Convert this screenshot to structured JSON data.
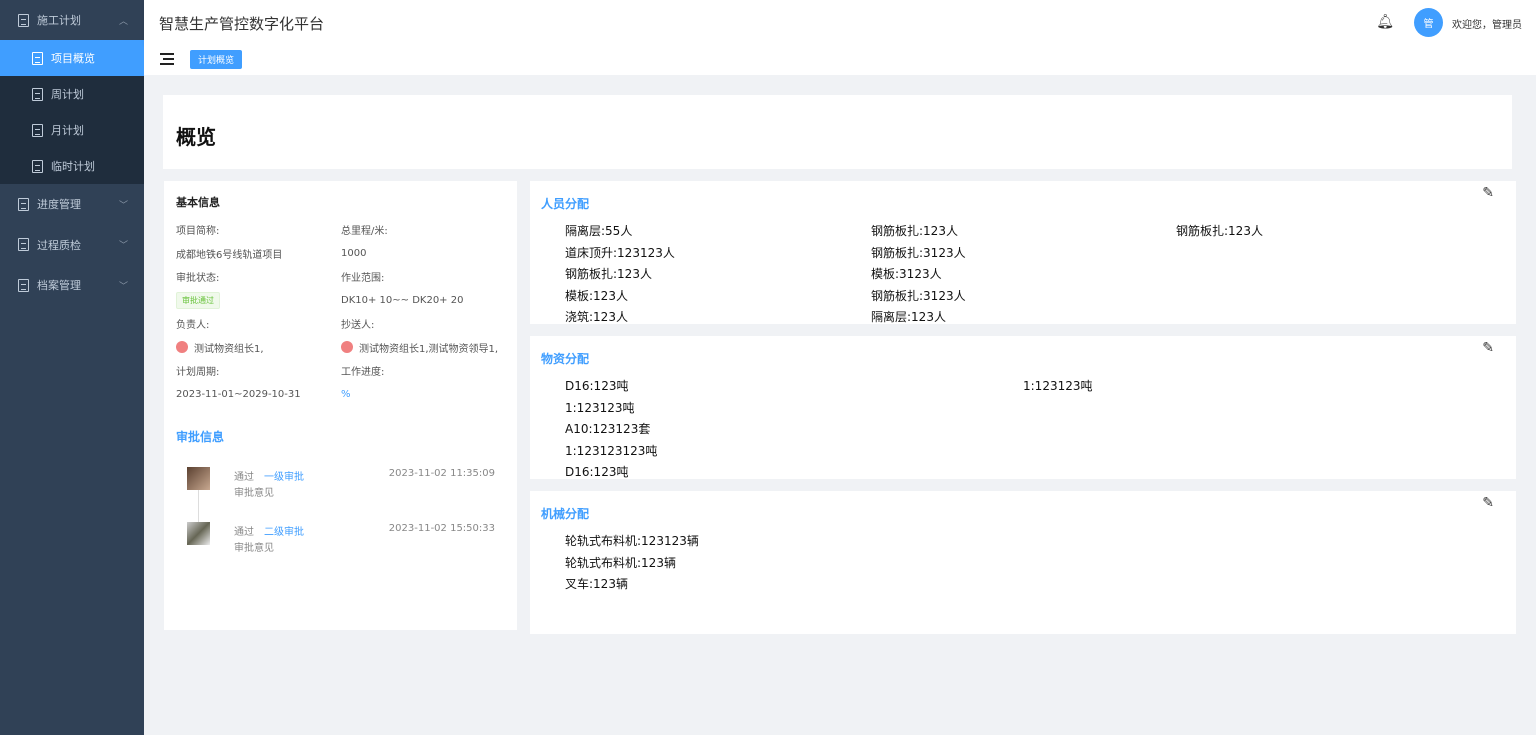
{
  "sidebar": {
    "groups": [
      {
        "label": "施工计划",
        "expanded": true,
        "children": [
          {
            "label": "项目概览",
            "active": true
          },
          {
            "label": "周计划"
          },
          {
            "label": "月计划"
          },
          {
            "label": "临时计划"
          }
        ]
      },
      {
        "label": "进度管理"
      },
      {
        "label": "过程质检"
      },
      {
        "label": "档案管理"
      }
    ]
  },
  "header": {
    "title": "智慧生产管控数字化平台",
    "avatar": "管",
    "welcome": "欢迎您，管理员"
  },
  "tags": {
    "active": "计划概览"
  },
  "overview": {
    "title": "概览"
  },
  "basic": {
    "title": "基本信息",
    "name_label": "项目简称:",
    "name": "成都地铁6号线轨道项目",
    "length_label": "总里程/米:",
    "length": "1000",
    "status_label": "审批状态:",
    "status": "审批通过",
    "range_label": "作业范围:",
    "range": "DK10+ 10~~ DK20+ 20",
    "owner_label": "负责人:",
    "owner": "测试物资组长1,",
    "cc_label": "抄送人:",
    "cc": "测试物资组长1,测试物资领导1,",
    "period_label": "计划周期:",
    "period": "2023-11-01~2029-10-31",
    "progress_label": "工作进度:",
    "progress": "%"
  },
  "approval": {
    "title": "审批信息",
    "items": [
      {
        "status": "通过",
        "level": "一级审批",
        "time": "2023-11-02 11:35:09",
        "opinion": "审批意见"
      },
      {
        "status": "通过",
        "level": "二级审批",
        "time": "2023-11-02 15:50:33",
        "opinion": "审批意见"
      }
    ]
  },
  "personnel": {
    "title": "人员分配",
    "columns": [
      [
        "隔离层:55人",
        "道床顶升:123123人",
        "钢筋板扎:123人",
        "模板:123人",
        "浇筑:123人"
      ],
      [
        "钢筋板扎:123人",
        "钢筋板扎:3123人",
        "模板:3123人",
        "钢筋板扎:3123人",
        "隔离层:123人"
      ],
      [
        "钢筋板扎:123人"
      ]
    ]
  },
  "materials": {
    "title": "物资分配",
    "columns": [
      [
        "D16:123吨",
        "1:123123吨",
        "A10:123123套",
        "1:123123123吨",
        "D16:123吨"
      ],
      [
        "1:123123吨"
      ]
    ]
  },
  "machinery": {
    "title": "机械分配",
    "columns": [
      [
        "轮轨式布料机:123123辆",
        "轮轨式布料机:123辆",
        "叉车:123辆"
      ]
    ]
  }
}
